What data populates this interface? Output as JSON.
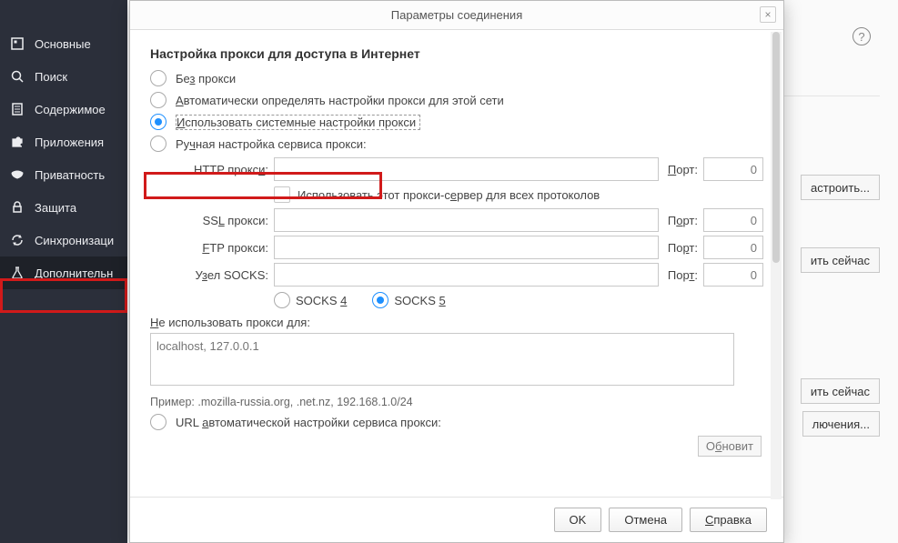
{
  "sidebar": {
    "items": [
      {
        "label": "Основные"
      },
      {
        "label": "Поиск"
      },
      {
        "label": "Содержимое"
      },
      {
        "label": "Приложения"
      },
      {
        "label": "Приватность"
      },
      {
        "label": "Защита"
      },
      {
        "label": "Синхронизаци"
      },
      {
        "label": "Дополнительн"
      }
    ]
  },
  "bg": {
    "btn1": "астроить...",
    "btn2": "ить сейчас",
    "btn3": "ить сейчас",
    "btn4": "лючения...",
    "help": "?"
  },
  "modal": {
    "title": "Параметры соединения",
    "close": "×",
    "heading": "Настройка прокси для доступа в Интернет",
    "opt_none_pre": "Бе",
    "opt_none_ul": "з",
    "opt_none_post": " прокси",
    "opt_auto_pre": "",
    "opt_auto_ul": "А",
    "opt_auto_post": "втоматически определять настройки прокси для этой сети",
    "opt_sys_pre": "",
    "opt_sys_ul": "И",
    "opt_sys_post": "спользовать системные настройки прокси",
    "opt_manual_pre": "Ру",
    "opt_manual_ul": "ч",
    "opt_manual_post": "ная настройка сервиса прокси:",
    "http_label_pre": "HTTP прокс",
    "http_label_ul": "и",
    "http_label_post": ":",
    "port_label_pre": "",
    "port_label_ul": "П",
    "port_label_post": "орт:",
    "port_value": "0",
    "use_all_pre": "Использовать этот прокси-с",
    "use_all_ul": "е",
    "use_all_post": "рвер для всех протоколов",
    "ssl_label_pre": "SS",
    "ssl_label_ul": "L",
    "ssl_label_post": " прокси:",
    "port2_pre": "П",
    "port2_ul": "о",
    "port2_post": "рт:",
    "ftp_label_pre": "",
    "ftp_label_ul": "F",
    "ftp_label_post": "TP прокси:",
    "port3_pre": "По",
    "port3_ul": "р",
    "port3_post": "т:",
    "socks_label_pre": "У",
    "socks_label_ul": "з",
    "socks_label_post": "ел SOCKS:",
    "port4_pre": "Пор",
    "port4_ul": "т",
    "port4_post": ":",
    "socks4_pre": "SOCKS ",
    "socks4_ul": "4",
    "socks5_pre": "SOCKS ",
    "socks5_ul": "5",
    "noproxy_label_pre": "",
    "noproxy_label_ul": "Н",
    "noproxy_label_post": "е использовать прокси для:",
    "noproxy_placeholder": "localhost, 127.0.0.1",
    "example": "Пример: .mozilla-russia.org, .net.nz, 192.168.1.0/24",
    "url_auto_pre": "URL ",
    "url_auto_ul": "а",
    "url_auto_post": "втоматической настройки сервиса прокси:",
    "refresh_pre": "О",
    "refresh_ul": "б",
    "refresh_post": "новит",
    "ok": "OK",
    "cancel": "Отмена",
    "help_pre": "",
    "help_ul": "С",
    "help_post": "правка"
  }
}
